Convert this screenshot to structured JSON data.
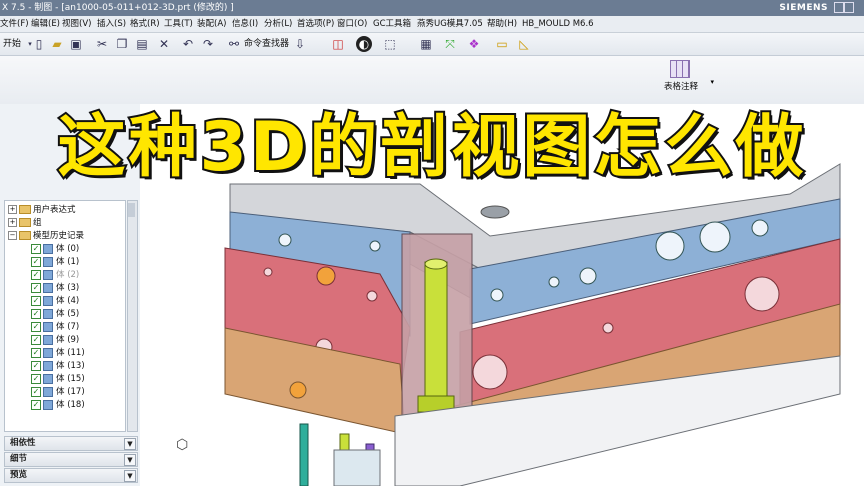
{
  "titlebar": {
    "title": "X 7.5 - 制图 - [an1000-05-011+012-3D.prt  (修改的) ]",
    "brand": "SIEMENS"
  },
  "menu": [
    "文件(F)",
    "编辑(E)",
    "视图(V)",
    "插入(S)",
    "格式(R)",
    "工具(T)",
    "装配(A)",
    "信息(I)",
    "分析(L)",
    "首选项(P)",
    "窗口(O)",
    "GC工具箱",
    "燕秀UG模具7.05",
    "帮助(H)",
    "HB_MOULD M6.6"
  ],
  "toolbar": {
    "start_label": "开始",
    "command_finder_label": "命令查找器"
  },
  "ribbon": {
    "table_note_label": "表格注释"
  },
  "navigator": {
    "tree": [
      {
        "label": "用户表达式",
        "kind": "folder",
        "expander": "+"
      },
      {
        "label": "组",
        "kind": "folder",
        "expander": "+"
      },
      {
        "label": "模型历史记录",
        "kind": "folder",
        "expander": "-"
      },
      {
        "label": "体 (0)",
        "kind": "body"
      },
      {
        "label": "体 (1)",
        "kind": "body"
      },
      {
        "label": "体 (2)",
        "kind": "body",
        "dim": true
      },
      {
        "label": "体 (3)",
        "kind": "body"
      },
      {
        "label": "体 (4)",
        "kind": "body"
      },
      {
        "label": "体 (5)",
        "kind": "body"
      },
      {
        "label": "体 (7)",
        "kind": "body"
      },
      {
        "label": "体 (9)",
        "kind": "body"
      },
      {
        "label": "体 (11)",
        "kind": "body"
      },
      {
        "label": "体 (13)",
        "kind": "body"
      },
      {
        "label": "体 (15)",
        "kind": "body"
      },
      {
        "label": "体 (17)",
        "kind": "body"
      },
      {
        "label": "体 (18)",
        "kind": "body"
      }
    ],
    "panels": [
      "相依性",
      "细节",
      "预览"
    ]
  },
  "headline": "这种3D的剖视图怎么做",
  "colors": {
    "plate_blue": "#8db0d6",
    "plate_red": "#d9707a",
    "plate_tan": "#d9a574",
    "pin_yellow": "#c9e03a",
    "plate_grey": "#d4d6da",
    "headline": "#ffe600"
  }
}
